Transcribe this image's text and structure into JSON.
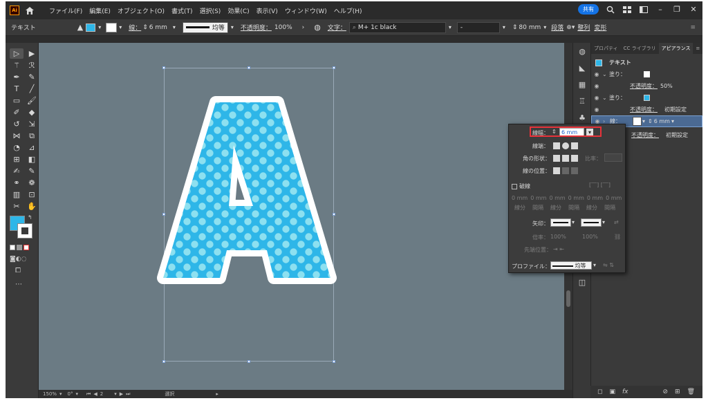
{
  "titlebar": {
    "logo_text": "Ai",
    "menu": [
      "ファイル(F)",
      "編集(E)",
      "オブジェクト(O)",
      "書式(T)",
      "選択(S)",
      "効果(C)",
      "表示(V)",
      "ウィンドウ(W)",
      "ヘルプ(H)"
    ],
    "share_label": "共有",
    "icons": [
      "search-icon",
      "workspace-icon",
      "minimize-icon",
      "restore-icon",
      "close-icon"
    ]
  },
  "control_bar": {
    "selection_type": "テキスト",
    "stroke_label": "線：",
    "stroke_width": "6 mm",
    "stroke_profile": "均等",
    "opacity_label": "不透明度：",
    "opacity_value": "100%",
    "char_label": "文字：",
    "font_value": "M+ 1c black",
    "font_style_value": "-",
    "size_value": "80 mm",
    "paragraph_label": "段落",
    "arrange_label": "整列",
    "transform_label": "変形"
  },
  "colors": {
    "fill_blue": "#2eb6e8",
    "dot_light": "#8de0f0",
    "canvas_bg": "#6b7b84",
    "highlight_red": "#e8323a"
  },
  "appearance_panel": {
    "tabs": [
      "プロパティ",
      "CC ライブラリ",
      "アピアランス"
    ],
    "active_tab": "アピアランス",
    "object_label": "テキスト",
    "rows": [
      {
        "label": "塗り：",
        "type": "fill-white"
      },
      {
        "label": "不透明度：",
        "value": "50%"
      },
      {
        "label": "塗り：",
        "type": "fill-blue"
      },
      {
        "label": "不透明度：",
        "value": "初期設定"
      },
      {
        "label": "線：",
        "value": "6 mm"
      },
      {
        "label": "不透明度：",
        "value": "初期設定"
      }
    ]
  },
  "stroke_popup": {
    "width_label": "線幅：",
    "width_value": "6 mm",
    "cap_label": "線端：",
    "corner_label": "角の形状：",
    "limit_label": "比率：",
    "align_label": "線の位置：",
    "dash_label": "破線",
    "dash_fields": [
      "0 mm",
      "0 mm",
      "0 mm",
      "0 mm",
      "0 mm",
      "0 mm"
    ],
    "dash_captions": [
      "線分",
      "間隔",
      "線分",
      "間隔",
      "線分",
      "間隔"
    ],
    "arrow_label": "矢印：",
    "scale_label": "倍率：",
    "scale_values": [
      "100%",
      "100%"
    ],
    "tip_label": "先端位置：",
    "profile_label": "プロファイル：",
    "profile_value": "均等"
  },
  "status_bar": {
    "zoom": "150%",
    "rotate": "0°",
    "artboard": "2",
    "mode": "選択"
  }
}
